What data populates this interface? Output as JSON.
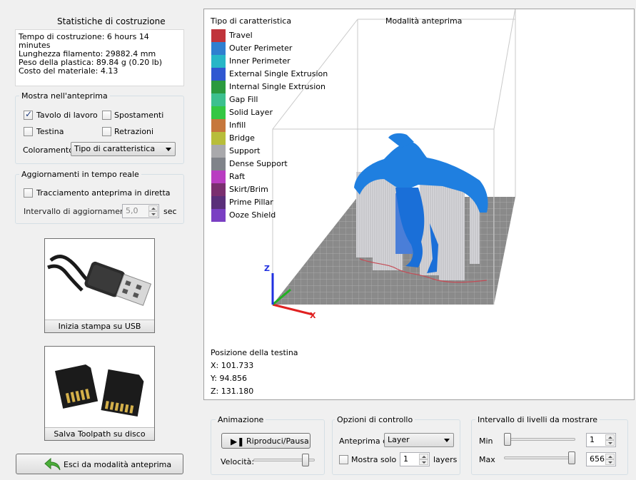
{
  "stats": {
    "title": "Statistiche di costruzione",
    "build_time": "Tempo di costruzione: 6 hours 14 minutes",
    "filament_length": "Lunghezza filamento: 29882.4 mm",
    "plastic_weight": "Peso della plastica: 89.84 g (0.20 lb)",
    "material_cost": "Costo del materiale: 4.13"
  },
  "show_preview": {
    "title": "Mostra nell'anteprima",
    "build_table": {
      "label": "Tavolo di lavoro",
      "checked": true
    },
    "travel_moves": {
      "label": "Spostamenti",
      "checked": false
    },
    "toolhead": {
      "label": "Testina",
      "checked": false
    },
    "retractions": {
      "label": "Retrazioni",
      "checked": false
    },
    "coloring_label": "Coloramento",
    "coloring_value": "Tipo di caratteristica"
  },
  "realtime": {
    "title": "Aggiornamenti in tempo reale",
    "live_tracking": {
      "label": "Tracciamento anteprima in diretta",
      "checked": false
    },
    "interval_label": "Intervallo di aggiornamento",
    "interval_value": "5,0",
    "interval_unit": "sec"
  },
  "actions": {
    "usb_print": "Inizia stampa su USB",
    "save_toolpath": "Salva Toolpath su disco",
    "exit_preview": "Esci da modalità anteprima"
  },
  "viewport": {
    "legend_title": "Tipo di caratteristica",
    "mode_title": "Modalità anteprima",
    "legend": [
      {
        "label": "Travel",
        "color": "#c0343b"
      },
      {
        "label": "Outer Perimeter",
        "color": "#2f7fd0"
      },
      {
        "label": "Inner Perimeter",
        "color": "#27b6c7"
      },
      {
        "label": "External Single Extrusion",
        "color": "#2f57d1"
      },
      {
        "label": "Internal Single Extrusion",
        "color": "#2b9a3f"
      },
      {
        "label": "Gap Fill",
        "color": "#3cc08f"
      },
      {
        "label": "Solid Layer",
        "color": "#34c743"
      },
      {
        "label": "Infill",
        "color": "#c6773c"
      },
      {
        "label": "Bridge",
        "color": "#b8bd3a"
      },
      {
        "label": "Support",
        "color": "#a9a9ac"
      },
      {
        "label": "Dense Support",
        "color": "#80838a"
      },
      {
        "label": "Raft",
        "color": "#b93dc1"
      },
      {
        "label": "Skirt/Brim",
        "color": "#7a2f6f"
      },
      {
        "label": "Prime Pillar",
        "color": "#5a2f7a"
      },
      {
        "label": "Ooze Shield",
        "color": "#7a3fc3"
      }
    ],
    "head_position_title": "Posizione della testina",
    "x": "X: 101.733",
    "y": "Y: 94.856",
    "z": "Z: 131.180",
    "axis_z": "Z",
    "axis_x": "X"
  },
  "animation": {
    "title": "Animazione",
    "play_pause": "Riproduci/Pausa",
    "speed_label": "Velocità:",
    "speed_fraction": 0.9
  },
  "control": {
    "title": "Opzioni di controllo",
    "preview_by_label": "Anteprima di",
    "preview_by_value": "Layer",
    "show_only_label": "Mostra solo",
    "show_only_checked": false,
    "show_only_value": "1",
    "layers_label": "layers"
  },
  "layer_range": {
    "title": "Intervallo di livelli da mostrare",
    "min_label": "Min",
    "min_value": "1",
    "max_label": "Max",
    "max_value": "656",
    "min_fraction": 0.0,
    "max_fraction": 1.0
  }
}
